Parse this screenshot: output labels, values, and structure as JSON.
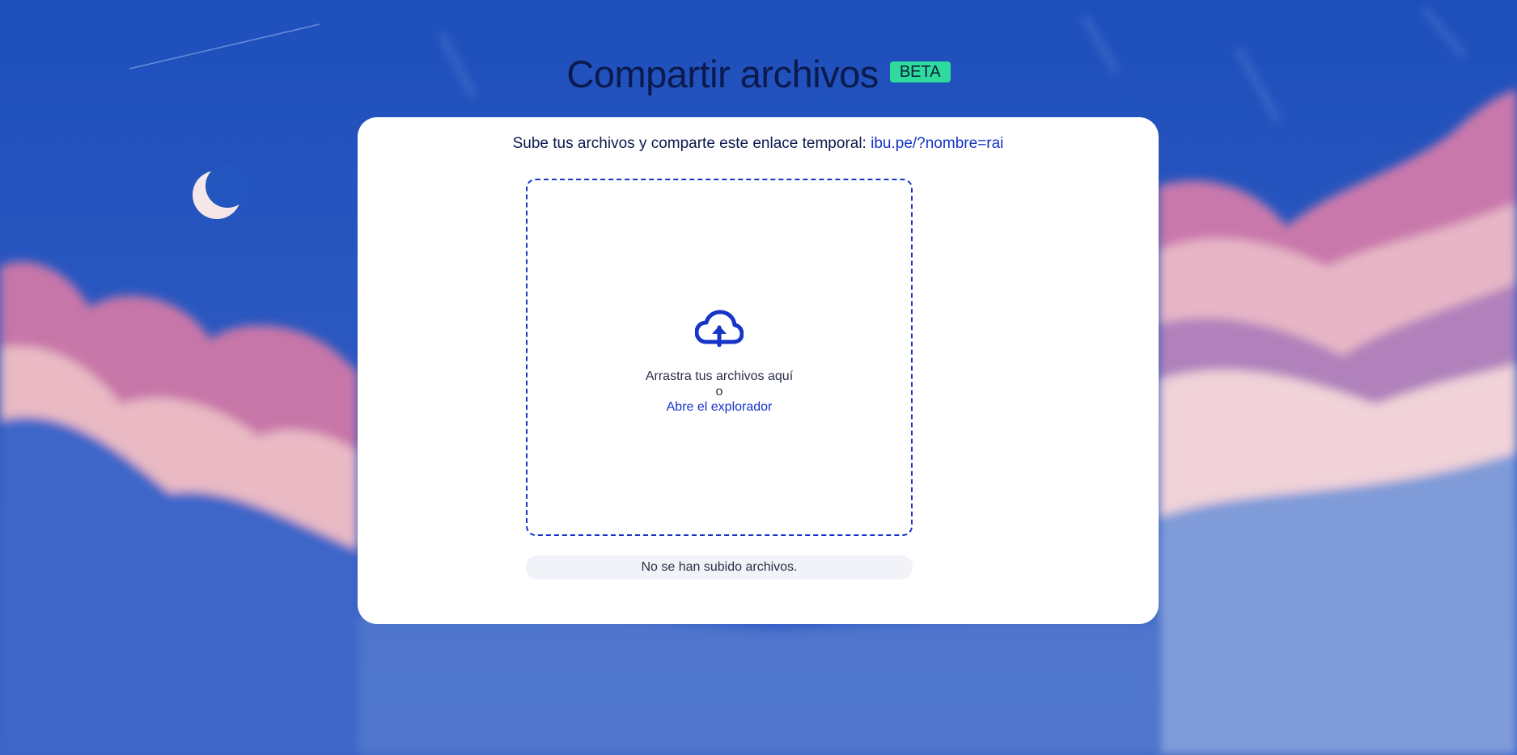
{
  "header": {
    "title": "Compartir archivos",
    "badge": "BETA"
  },
  "card": {
    "intro_text": "Sube tus archivos y comparte este enlace temporal: ",
    "share_link": "ibu.pe/?nombre=rai"
  },
  "dropzone": {
    "icon": "cloud-upload-icon",
    "drag_text": "Arrastra tus archivos aquí",
    "or_text": "o",
    "browse_label": "Abre el explorador"
  },
  "status": {
    "empty_text": "No se han subido archivos."
  },
  "colors": {
    "accent": "#1634c8",
    "badge": "#2edb9c",
    "title": "#0b1a4d",
    "sky": "#2f57c2"
  }
}
